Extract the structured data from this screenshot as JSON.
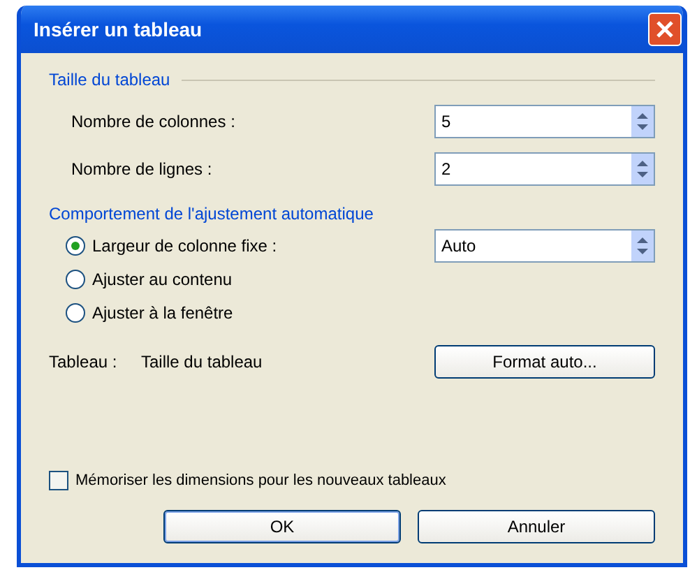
{
  "window": {
    "title": "Insérer un tableau"
  },
  "table_size": {
    "heading": "Taille du tableau",
    "fields": [
      {
        "label": "Nombre de colonnes :",
        "value": "5"
      },
      {
        "label": "Nombre de lignes :",
        "value": "2"
      }
    ]
  },
  "autofit": {
    "heading": "Comportement de l'ajustement automatique",
    "options": [
      {
        "label": "Largeur de colonne fixe :",
        "selected": true,
        "value": "Auto"
      },
      {
        "label": "Ajuster au contenu",
        "selected": false
      },
      {
        "label": "Ajuster à la fenêtre",
        "selected": false
      }
    ]
  },
  "style": {
    "label": "Tableau :",
    "value": "Taille du tableau",
    "button": "Format auto..."
  },
  "remember": {
    "label": "Mémoriser les dimensions pour les nouveaux tableaux",
    "checked": false
  },
  "buttons": [
    "OK",
    "Annuler"
  ]
}
